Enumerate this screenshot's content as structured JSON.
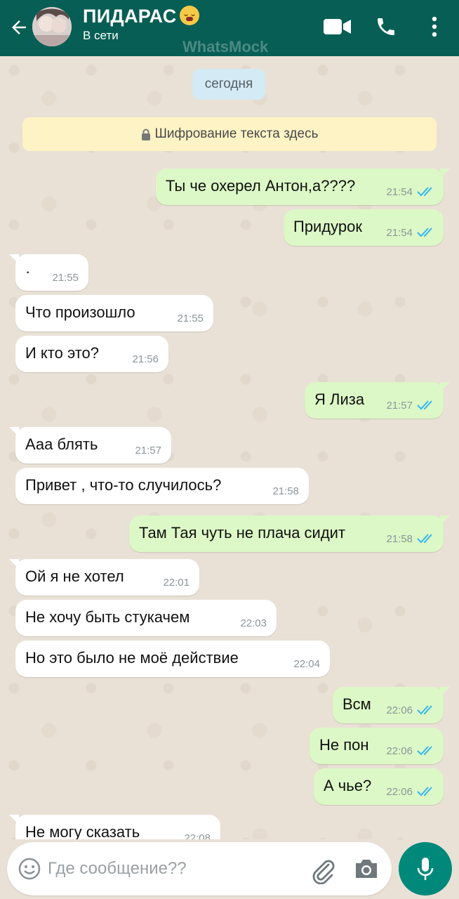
{
  "header": {
    "contact_name": "ПИДАРАС",
    "status": "В сети",
    "watermark": "WhatsMock",
    "icons": [
      "back-arrow-icon",
      "video-call-icon",
      "phone-icon",
      "more-vert-icon"
    ]
  },
  "chat": {
    "date_label": "сегодня",
    "encryption_note": "Шифрование текста здесь",
    "messages": [
      {
        "direction": "out",
        "text": "Ты че охерел Антон,а????",
        "time": "21:54",
        "read": true
      },
      {
        "direction": "out",
        "text": "Придурок",
        "time": "21:54",
        "read": true
      },
      {
        "direction": "in",
        "text": "·",
        "time": "21:55"
      },
      {
        "direction": "in",
        "text": "Что произошло",
        "time": "21:55"
      },
      {
        "direction": "in",
        "text": "И кто это?",
        "time": "21:56"
      },
      {
        "direction": "out",
        "text": "Я Лиза",
        "time": "21:57",
        "read": true
      },
      {
        "direction": "in",
        "text": "Ааа блять",
        "time": "21:57"
      },
      {
        "direction": "in",
        "text": "Привет , что-то случилось?",
        "time": "21:58"
      },
      {
        "direction": "out",
        "text": "Там Тая чуть не плача сидит",
        "time": "21:58",
        "read": true
      },
      {
        "direction": "in",
        "text": "Ой я не хотел",
        "time": "22:01"
      },
      {
        "direction": "in",
        "text": "Не хочу быть стукачем",
        "time": "22:03"
      },
      {
        "direction": "in",
        "text": "Но это было не моё действие",
        "time": "22:04"
      },
      {
        "direction": "out",
        "text": "Всм",
        "time": "22:06",
        "read": true
      },
      {
        "direction": "out",
        "text": "Не пон",
        "time": "22:06",
        "read": true
      },
      {
        "direction": "out",
        "text": "А чье?",
        "time": "22:06",
        "read": true
      },
      {
        "direction": "in",
        "text": "Не могу сказать",
        "time": "22:08"
      }
    ]
  },
  "composer": {
    "placeholder": "Где сообщение??"
  },
  "colors": {
    "header_bg": "#075e54",
    "outgoing_bubble": "#dcf8c6",
    "incoming_bubble": "#ffffff",
    "read_ticks": "#34b7f1",
    "fab": "#00897b"
  }
}
